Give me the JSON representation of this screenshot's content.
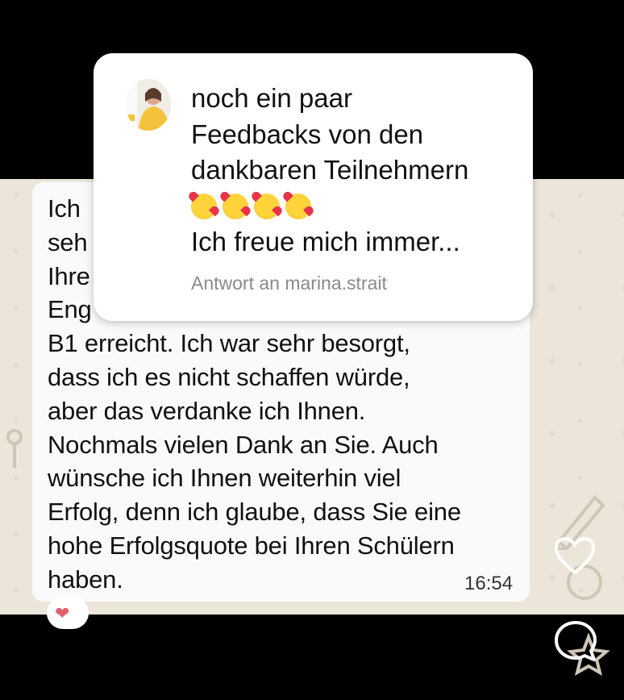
{
  "message": {
    "lines": [
      "Ich",
      "seh",
      "Ihre",
      "Eng",
      "B1 erreicht. Ich war sehr besorgt,",
      "dass ich es nicht schaffen würde,",
      "aber das verdanke ich Ihnen.",
      "Nochmals vielen Dank an Sie. Auch",
      "wünsche ich Ihnen weiterhin viel",
      "Erfolg, denn ich glaube, dass Sie eine",
      "hohe Erfolgsquote bei Ihren Schülern",
      "haben."
    ],
    "time": "16:54",
    "reaction": "❤"
  },
  "reply": {
    "lines": [
      "noch ein paar",
      "Feedbacks von den",
      "dankbaren Teilnehmern"
    ],
    "emojis": [
      "smiling-face-with-hearts",
      "smiling-face-with-hearts",
      "smiling-face-with-hearts",
      "smiling-face-with-hearts"
    ],
    "preview": "Ich freue mich immer...",
    "subtitle": "Antwort an marina.strait"
  },
  "icons": {
    "like": "heart-outline-icon",
    "comment": "comment-bubble-icon"
  },
  "colors": {
    "chat_background": "#ece5da",
    "bubble": "#fafafa",
    "reply_card": "#ffffff",
    "subtitle": "#8a8a8a"
  }
}
